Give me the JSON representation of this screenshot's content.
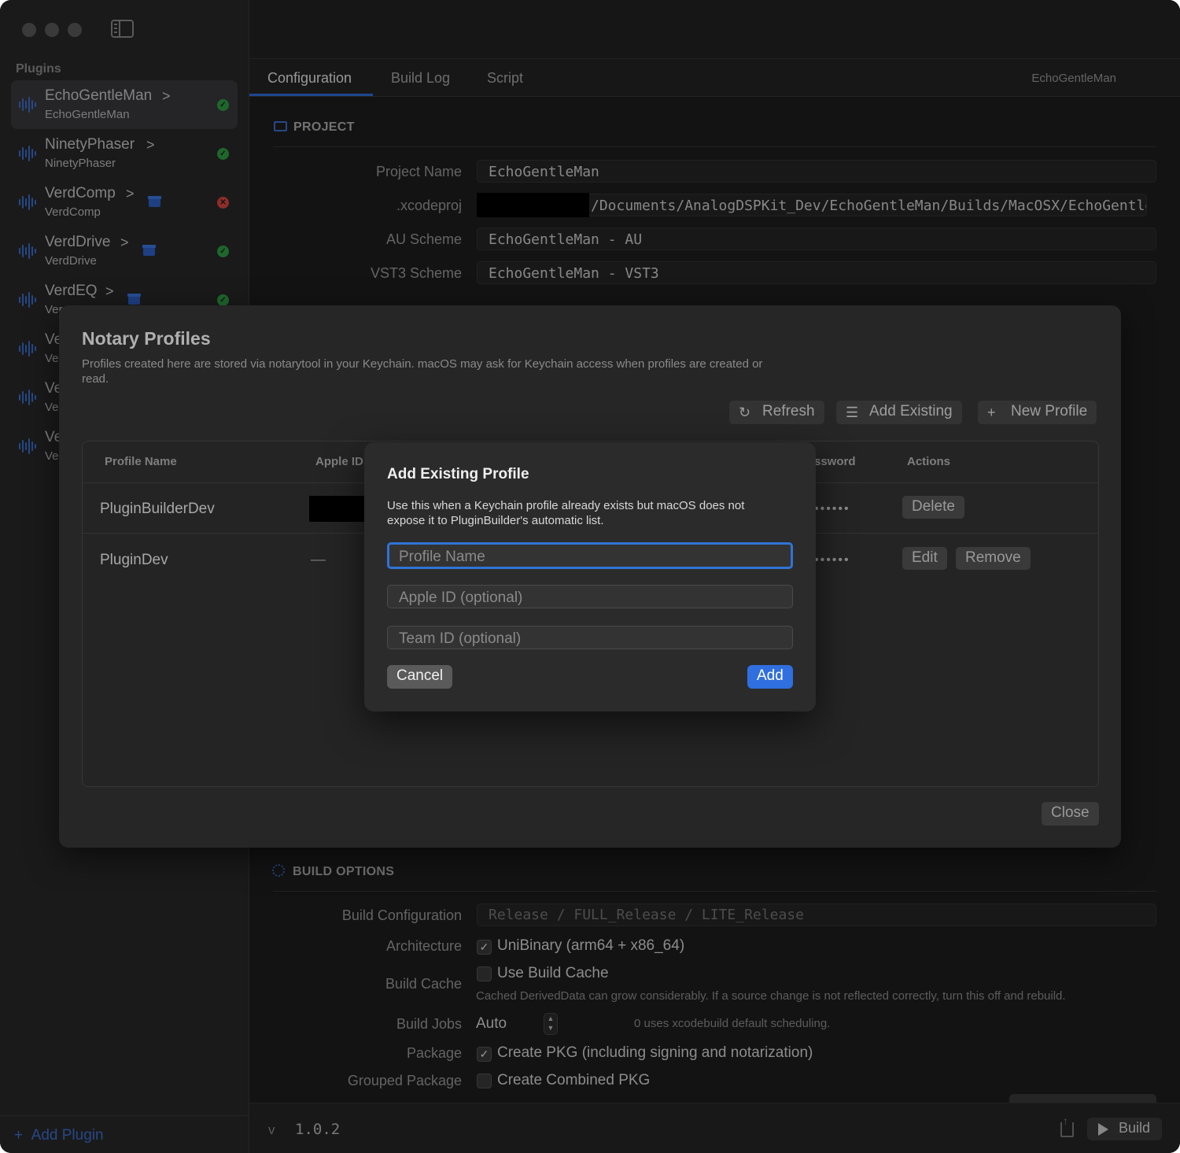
{
  "sidebar": {
    "section_label": "Plugins",
    "items": [
      {
        "name": "EchoGentleMan",
        "sub": "EchoGentleMan",
        "status": "ok",
        "archive": false
      },
      {
        "name": "NinetyPhaser",
        "sub": "NinetyPhaser",
        "status": "ok",
        "archive": false
      },
      {
        "name": "VerdComp",
        "sub": "VerdComp",
        "status": "error",
        "archive": true
      },
      {
        "name": "VerdDrive",
        "sub": "VerdDrive",
        "status": "ok",
        "archive": true
      },
      {
        "name": "VerdEQ",
        "sub": "Ver",
        "status": "ok",
        "archive": true
      },
      {
        "name": "Ve",
        "sub": "Ve"
      },
      {
        "name": "Ve",
        "sub": "Ve"
      },
      {
        "name": "Ve",
        "sub": "Ve"
      }
    ],
    "add_plugin_label": "Add Plugin",
    "add_plugin_icon": "+"
  },
  "tabs": {
    "items": [
      "Configuration",
      "Build Log",
      "Script"
    ],
    "active": "Configuration",
    "breadcrumb": "EchoGentleMan"
  },
  "project": {
    "section_title": "PROJECT",
    "fields": [
      {
        "label": "Project Name",
        "value": "EchoGentleMan"
      },
      {
        "label": ".xcodeproj",
        "value": "/Documents/AnalogDSPKit_Dev/EchoGentleMan/Builds/MacOSX/EchoGentleMan.xcodeproj"
      },
      {
        "label": "AU Scheme",
        "value": "EchoGentleMan - AU"
      },
      {
        "label": "VST3 Scheme",
        "value": "EchoGentleMan - VST3"
      }
    ]
  },
  "build_options": {
    "section_title": "BUILD OPTIONS",
    "build_configuration_label": "Build Configuration",
    "build_configuration_placeholder": "Release / FULL_Release / LITE_Release",
    "architecture_label": "Architecture",
    "architecture_option": "UniBinary (arm64 + x86_64)",
    "architecture_checked": true,
    "build_cache_label": "Build Cache",
    "build_cache_option": "Use Build Cache",
    "build_cache_checked": false,
    "build_cache_hint": "Cached DerivedData can grow considerably. If a source change is not reflected correctly, turn this off and rebuild.",
    "build_jobs_label": "Build Jobs",
    "build_jobs_value": "Auto",
    "build_jobs_hint": "0 uses xcodebuild default scheduling.",
    "package_label": "Package",
    "package_option": "Create PKG (including signing and notarization)",
    "package_checked": true,
    "grouped_package_label": "Grouped Package",
    "grouped_package_option": "Create Combined PKG",
    "grouped_package_checked": false
  },
  "footer": {
    "version_prefix": "v",
    "version": "1.0.2",
    "build_label": "Build"
  },
  "notary": {
    "title": "Notary Profiles",
    "description": "Profiles created here are stored via notarytool in your Keychain. macOS may ask for Keychain access when profiles are created or read.",
    "refresh_label": "Refresh",
    "add_existing_label": "Add Existing",
    "new_profile_label": "New Profile",
    "columns": {
      "profile_name": "Profile Name",
      "apple_id": "Apple ID",
      "password": "ssword",
      "actions": "Actions"
    },
    "rows": [
      {
        "profile_name": "PluginBuilderDev",
        "apple_id": "",
        "password": "••••••",
        "actions": [
          "Delete"
        ]
      },
      {
        "profile_name": "PluginDev",
        "apple_id": "—",
        "password": "••••••",
        "actions": [
          "Edit",
          "Remove"
        ]
      }
    ],
    "close_label": "Close"
  },
  "add_existing_dialog": {
    "title": "Add Existing Profile",
    "description": "Use this when a Keychain profile already exists but macOS does not expose it to PluginBuilder's automatic list.",
    "profile_name_placeholder": "Profile Name",
    "apple_id_placeholder": "Apple ID (optional)",
    "team_id_placeholder": "Team ID (optional)",
    "cancel_label": "Cancel",
    "add_label": "Add"
  },
  "colors": {
    "accent": "#2f6fdf",
    "ok": "#2f9e44",
    "error": "#d9463f"
  }
}
